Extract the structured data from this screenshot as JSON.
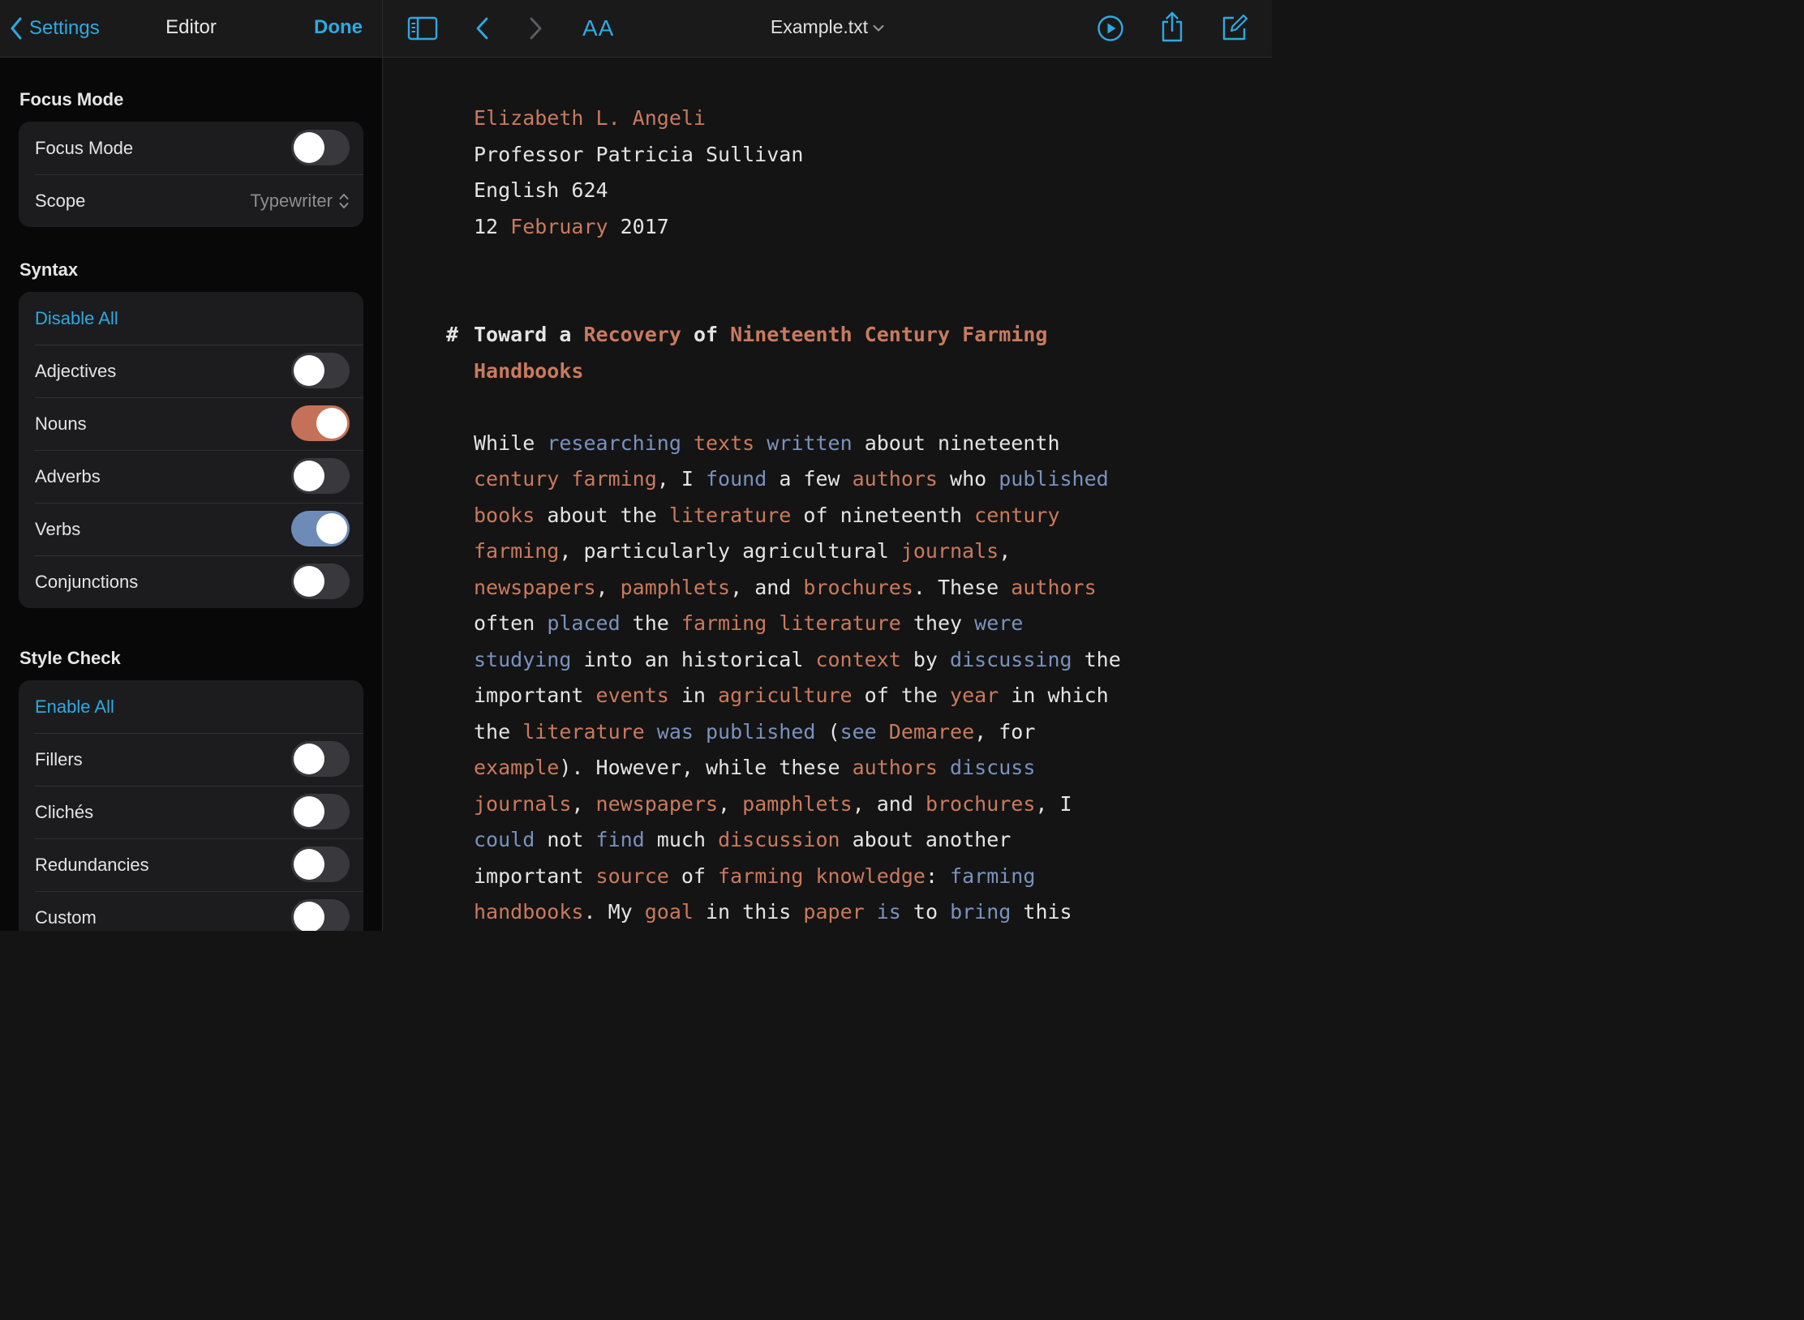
{
  "sidebar": {
    "back_label": "Settings",
    "title": "Editor",
    "done_label": "Done",
    "focus_section": {
      "title": "Focus Mode",
      "rows": [
        {
          "label": "Focus Mode",
          "state": "off"
        },
        {
          "label": "Scope",
          "value": "Typewriter"
        }
      ]
    },
    "syntax_section": {
      "title": "Syntax",
      "action": "Disable All",
      "rows": [
        {
          "label": "Adjectives",
          "state": "off"
        },
        {
          "label": "Nouns",
          "state": "on",
          "color": "#c5715a"
        },
        {
          "label": "Adverbs",
          "state": "off"
        },
        {
          "label": "Verbs",
          "state": "on",
          "color": "#6e8bb8"
        },
        {
          "label": "Conjunctions",
          "state": "off"
        }
      ]
    },
    "style_section": {
      "title": "Style Check",
      "action": "Enable All",
      "rows": [
        {
          "label": "Fillers",
          "state": "off"
        },
        {
          "label": "Clichés",
          "state": "off"
        },
        {
          "label": "Redundancies",
          "state": "off"
        },
        {
          "label": "Custom",
          "state": "off"
        }
      ]
    }
  },
  "toolbar": {
    "aa_label": "AA",
    "doc_title": "Example.txt"
  },
  "colors": {
    "accent": "#2fa9e0",
    "noun": "#c97a5e",
    "verb": "#7a92bd",
    "text": "#e4e4e4"
  },
  "document": {
    "lines": [
      [
        [
          "n",
          "Elizabeth L. Angeli"
        ]
      ],
      [
        [
          "t",
          "Professor Patricia Sullivan"
        ]
      ],
      [
        [
          "t",
          "English 624"
        ]
      ],
      [
        [
          "t",
          "12 "
        ],
        [
          "n",
          "February"
        ],
        [
          "t",
          " 2017"
        ]
      ],
      [],
      [],
      [
        [
          "t",
          "Toward a "
        ],
        [
          "n",
          "Recovery"
        ],
        [
          "t",
          " of "
        ],
        [
          "n",
          "Nineteenth Century Farming"
        ]
      ],
      [
        [
          "n",
          "Handbooks"
        ]
      ],
      [],
      [
        [
          "t",
          "While "
        ],
        [
          "v",
          "researching"
        ],
        [
          "t",
          " "
        ],
        [
          "n",
          "texts"
        ],
        [
          "t",
          " "
        ],
        [
          "v",
          "written"
        ],
        [
          "t",
          " about nineteenth"
        ]
      ],
      [
        [
          "n",
          "century"
        ],
        [
          "t",
          " "
        ],
        [
          "n",
          "farming"
        ],
        [
          "t",
          ", I "
        ],
        [
          "v",
          "found"
        ],
        [
          "t",
          " a few "
        ],
        [
          "n",
          "authors"
        ],
        [
          "t",
          " who "
        ],
        [
          "v",
          "published"
        ]
      ],
      [
        [
          "n",
          "books"
        ],
        [
          "t",
          " about the "
        ],
        [
          "n",
          "literature"
        ],
        [
          "t",
          " of nineteenth "
        ],
        [
          "n",
          "century"
        ]
      ],
      [
        [
          "n",
          "farming"
        ],
        [
          "t",
          ", particularly agricultural "
        ],
        [
          "n",
          "journals"
        ],
        [
          "t",
          ","
        ]
      ],
      [
        [
          "n",
          "newspapers"
        ],
        [
          "t",
          ", "
        ],
        [
          "n",
          "pamphlets"
        ],
        [
          "t",
          ", and "
        ],
        [
          "n",
          "brochures"
        ],
        [
          "t",
          ". These "
        ],
        [
          "n",
          "authors"
        ]
      ],
      [
        [
          "t",
          "often "
        ],
        [
          "v",
          "placed"
        ],
        [
          "t",
          " the "
        ],
        [
          "n",
          "farming"
        ],
        [
          "t",
          " "
        ],
        [
          "n",
          "literature"
        ],
        [
          "t",
          " they "
        ],
        [
          "v",
          "were"
        ]
      ],
      [
        [
          "v",
          "studying"
        ],
        [
          "t",
          " into an historical "
        ],
        [
          "n",
          "context"
        ],
        [
          "t",
          " by "
        ],
        [
          "v",
          "discussing"
        ],
        [
          "t",
          " the"
        ]
      ],
      [
        [
          "t",
          "important "
        ],
        [
          "n",
          "events"
        ],
        [
          "t",
          " in "
        ],
        [
          "n",
          "agriculture"
        ],
        [
          "t",
          " of the "
        ],
        [
          "n",
          "year"
        ],
        [
          "t",
          " in which"
        ]
      ],
      [
        [
          "t",
          "the "
        ],
        [
          "n",
          "literature"
        ],
        [
          "t",
          " "
        ],
        [
          "v",
          "was published"
        ],
        [
          "t",
          " ("
        ],
        [
          "v",
          "see"
        ],
        [
          "t",
          " "
        ],
        [
          "n",
          "Demaree"
        ],
        [
          "t",
          ", for"
        ]
      ],
      [
        [
          "n",
          "example"
        ],
        [
          "t",
          "). However, while these "
        ],
        [
          "n",
          "authors"
        ],
        [
          "t",
          " "
        ],
        [
          "v",
          "discuss"
        ]
      ],
      [
        [
          "n",
          "journals"
        ],
        [
          "t",
          ", "
        ],
        [
          "n",
          "newspapers"
        ],
        [
          "t",
          ", "
        ],
        [
          "n",
          "pamphlets"
        ],
        [
          "t",
          ", and "
        ],
        [
          "n",
          "brochures"
        ],
        [
          "t",
          ", I"
        ]
      ],
      [
        [
          "v",
          "could"
        ],
        [
          "t",
          " not "
        ],
        [
          "v",
          "find"
        ],
        [
          "t",
          " much "
        ],
        [
          "n",
          "discussion"
        ],
        [
          "t",
          " about another"
        ]
      ],
      [
        [
          "t",
          "important "
        ],
        [
          "n",
          "source"
        ],
        [
          "t",
          " of "
        ],
        [
          "n",
          "farming"
        ],
        [
          "t",
          " "
        ],
        [
          "n",
          "knowledge"
        ],
        [
          "t",
          ": "
        ],
        [
          "v",
          "farming"
        ]
      ],
      [
        [
          "n",
          "handbooks"
        ],
        [
          "t",
          ". My "
        ],
        [
          "n",
          "goal"
        ],
        [
          "t",
          " in this "
        ],
        [
          "n",
          "paper"
        ],
        [
          "t",
          " "
        ],
        [
          "v",
          "is"
        ],
        [
          "t",
          " to "
        ],
        [
          "v",
          "bring"
        ],
        [
          "t",
          " this"
        ]
      ]
    ],
    "heading_line_index": 6,
    "heading_marker": "#"
  }
}
